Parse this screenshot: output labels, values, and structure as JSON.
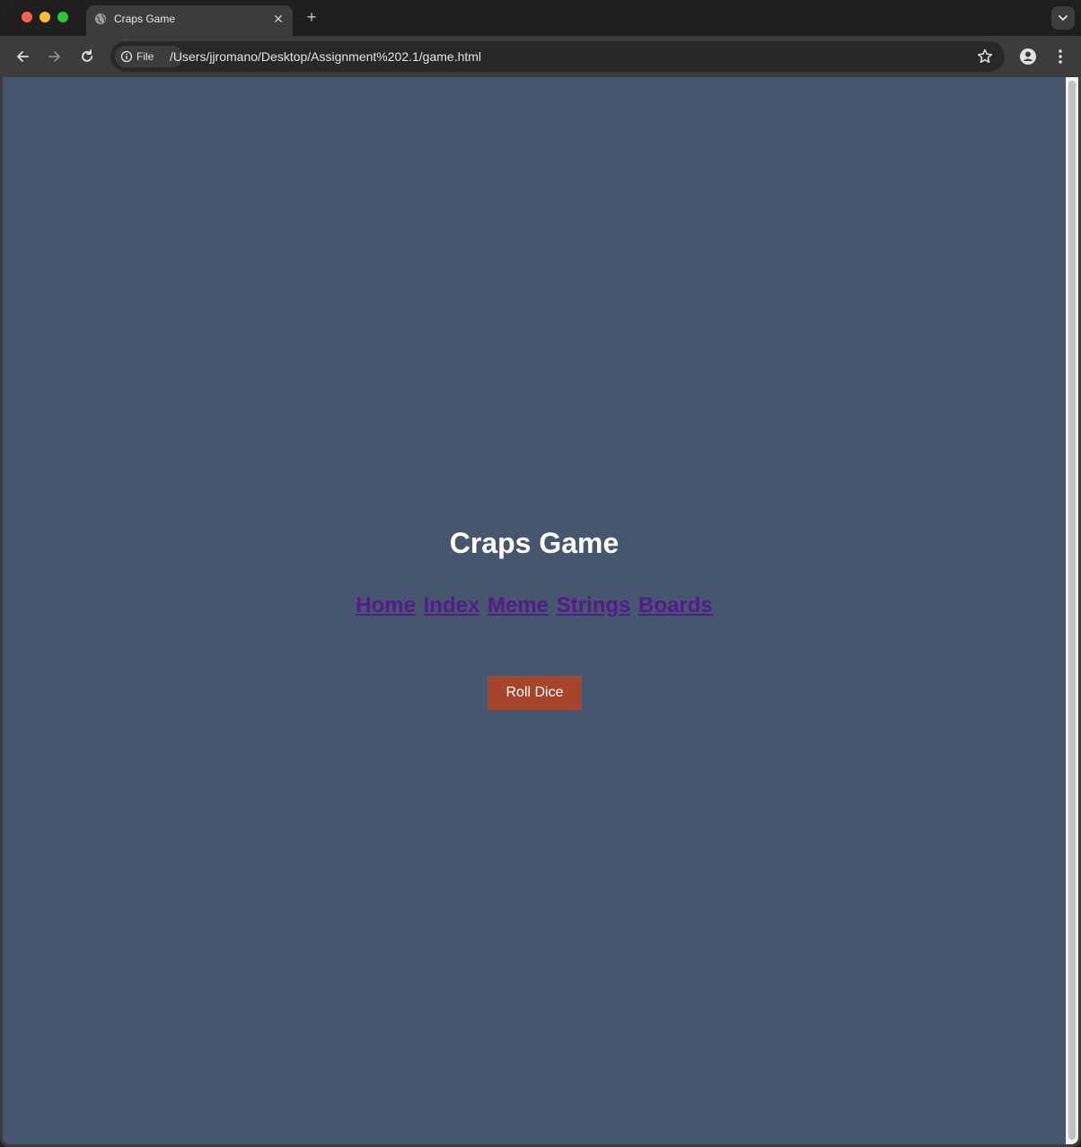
{
  "browser": {
    "tab": {
      "title": "Craps Game",
      "close_glyph": "✕"
    },
    "new_tab_glyph": "+",
    "omnibox": {
      "chip_label": "File",
      "url": "/Users/jjromano/Desktop/Assignment%202.1/game.html"
    },
    "icons": {
      "favicon": "globe-icon",
      "back": "arrow-left-icon",
      "forward": "arrow-right-icon",
      "reload": "reload-icon",
      "info": "info-icon",
      "bookmark": "star-icon",
      "profile": "profile-icon",
      "menu": "kebab-menu-icon",
      "tab_search": "chevron-down-icon"
    }
  },
  "page": {
    "background": "#46566f",
    "title": "Craps Game",
    "nav_links": [
      {
        "label": "Home"
      },
      {
        "label": "Index"
      },
      {
        "label": "Meme"
      },
      {
        "label": "Strings"
      },
      {
        "label": "Boards"
      }
    ],
    "link_color": "#551a8b",
    "roll_button": {
      "label": "Roll Dice",
      "color": "#a5452c"
    }
  }
}
